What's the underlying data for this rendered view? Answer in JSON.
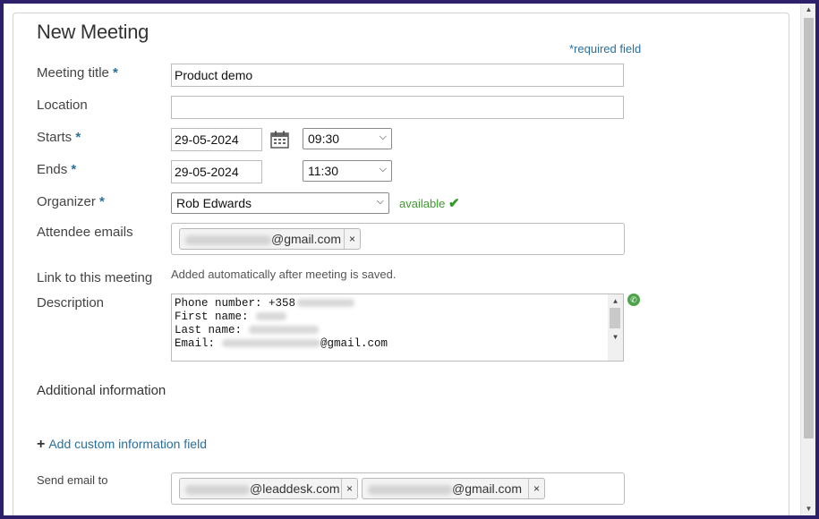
{
  "form": {
    "title": "New Meeting",
    "required_note": "*required field",
    "required_star": "*",
    "labels": {
      "meeting_title": "Meeting title",
      "location": "Location",
      "starts": "Starts",
      "ends": "Ends",
      "organizer": "Organizer",
      "attendee_emails": "Attendee emails",
      "link": "Link to this meeting",
      "description": "Description",
      "send_email_to": "Send email to"
    },
    "values": {
      "meeting_title": "Product demo",
      "location": "",
      "start_date": "29-05-2024",
      "start_time": "09:30",
      "end_date": "29-05-2024",
      "end_time": "11:30",
      "organizer": "Rob Edwards"
    },
    "availability": "available",
    "attendee_tag_domain": "@gmail.com",
    "link_text": "Added automatically after meeting is saved.",
    "description_lines": {
      "phone_label": "Phone number: +358",
      "first_name_label": "First name:",
      "last_name_label": "Last name:",
      "email_label": "Email:",
      "email_domain": "@gmail.com"
    },
    "additional_heading": "Additional information",
    "add_custom_field": "Add custom information field",
    "send_to_tags": [
      "@leaddesk.com",
      "@gmail.com"
    ],
    "remove_symbol": "×"
  },
  "icons": {
    "calendar": "calendar-icon",
    "check": "check-icon",
    "phone": "phone-icon",
    "chevron": "chevron-down-icon"
  },
  "colors": {
    "accent_blue": "#2a6f9e",
    "available_green": "#3e9a2e",
    "frame": "#2e1f6b"
  }
}
